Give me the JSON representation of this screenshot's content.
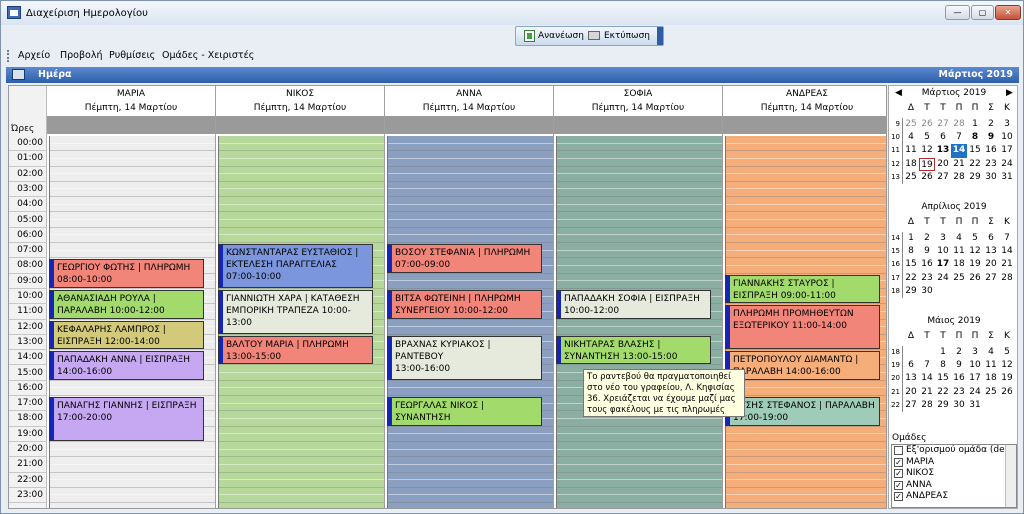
{
  "window": {
    "title": "Διαχείριση Ημερολογίου"
  },
  "toolbar": {
    "refresh_label": "Ανανέωση",
    "print_label": "Εκτύπωση"
  },
  "menu": [
    "Αρχείο",
    "Προβολή",
    "Ρυθμίσεις",
    "Ομάδες - Χειριστές"
  ],
  "daybar": {
    "view_label": "Ημέρα",
    "month_label": "Μάρτιος 2019"
  },
  "grid": {
    "hours_label": "Ώρες",
    "hours": [
      "00:00",
      "01:00",
      "02:00",
      "03:00",
      "04:00",
      "05:00",
      "06:00",
      "07:00",
      "08:00",
      "09:00",
      "10:00",
      "11:00",
      "12:00",
      "13:00",
      "14:00",
      "15:00",
      "16:00",
      "17:00",
      "18:00",
      "19:00",
      "20:00",
      "21:00",
      "22:00",
      "23:00"
    ],
    "columns": [
      {
        "name": "ΜΑΡΙΑ",
        "date": "Πέμπτη, 14 Μαρτίου",
        "color": "#eeeeee",
        "appointments": [
          {
            "title": "ΓΕΩΡΓΙΟΥ ΦΩΤΗΣ | ΠΛΗΡΩΜΗ",
            "time": "08:00-10:00",
            "color": "#f2857a",
            "start": 8,
            "end": 10
          },
          {
            "title": "ΑΘΑΝΑΣΙΑΔΗ ΡΟΥΛΑ | ΠΑΡΑΛΑΒΗ 10:00-12:00",
            "time": "",
            "color": "#a2db6b",
            "start": 10,
            "end": 12
          },
          {
            "title": "ΚΕΦΑΛΑΡΗΣ ΛΑΜΠΡΟΣ | ΕΙΣΠΡΑΞΗ 12:00-14:00",
            "time": "",
            "color": "#d3c97a",
            "start": 12,
            "end": 14
          },
          {
            "title": "ΠΑΠΑΔΑΚΗ ΑΝΝΑ | ΕΙΣΠΡΑΞΗ",
            "time": "14:00-16:00",
            "color": "#c6a8f2",
            "start": 14,
            "end": 16
          },
          {
            "title": "ΠΑΝΑΓΗΣ ΓΙΑΝΝΗΣ | ΕΙΣΠΡΑΞΗ",
            "time": "17:00-20:00",
            "color": "#c6a8f2",
            "start": 17,
            "end": 20
          }
        ]
      },
      {
        "name": "ΝΙΚΟΣ",
        "date": "Πέμπτη, 14 Μαρτίου",
        "color": "#b6d99b",
        "appointments": [
          {
            "title": "ΚΩΝΣΤΑΝΤΑΡΑΣ ΕΥΣΤΑΘΙΟΣ | ΕΚΤΕΛΕΣΗ ΠΑΡΑΓΓΕΛΙΑΣ",
            "time": "07:00-10:00",
            "color": "#7b96dd",
            "start": 7,
            "end": 10
          },
          {
            "title": "ΓΙΑΝΝΙΩΤΗ ΧΑΡΑ | ΚΑΤΑΘΕΣΗ ΕΜΠΟΡΙΚΗ ΤΡΑΠΕΖΑ 10:00-13:00",
            "time": "",
            "color": "#e6eadd",
            "start": 10,
            "end": 13
          },
          {
            "title": "ΒΑΛΤΟΥ ΜΑΡΙΑ | ΠΛΗΡΩΜΗ",
            "time": "13:00-15:00",
            "color": "#f2857a",
            "start": 13,
            "end": 15
          }
        ]
      },
      {
        "name": "ΑΝΝΑ",
        "date": "Πέμπτη, 14 Μαρτίου",
        "color": "#8b9fc0",
        "appointments": [
          {
            "title": "ΒΟΣΟΥ ΣΤΕΦΑΝΙΑ | ΠΛΗΡΩΜΗ",
            "time": "07:00-09:00",
            "color": "#f2857a",
            "start": 7,
            "end": 9
          },
          {
            "title": "ΒΙΤΣΑ ΦΩΤΕΙΝΗ | ΠΛΗΡΩΜΗ ΣΥΝΕΡΓΕΙΟΥ 10:00-12:00",
            "time": "",
            "color": "#f2857a",
            "start": 10,
            "end": 12
          },
          {
            "title": "ΒΡΑΧΝΑΣ ΚΥΡΙΑΚΟΣ | ΡΑΝΤΕΒΟΥ",
            "time": "13:00-16:00",
            "color": "#e6eadd",
            "start": 13,
            "end": 16
          },
          {
            "title": "ΓΕΩΡΓΑΛΑΣ ΝΙΚΟΣ | ΣΥΝΑΝΤΗΣΗ",
            "time": "17:00-19:00",
            "color": "#a2db6b",
            "start": 17,
            "end": 19
          }
        ]
      },
      {
        "name": "ΣΟΦΙΑ",
        "date": "Πέμπτη, 14 Μαρτίου",
        "color": "#8aaea2",
        "appointments": [
          {
            "title": "ΠΑΠΑΔΑΚΗ ΣΟΦΙΑ | ΕΙΣΠΡΑΞΗ",
            "time": "10:00-12:00",
            "color": "#e6eadd",
            "start": 10,
            "end": 12
          },
          {
            "title": "ΝΙΚΗΤΑΡΑΣ ΒΛΑΣΗΣ | ΣΥΝΑΝΤΗΣΗ 13:00-15:00",
            "time": "",
            "color": "#a2db6b",
            "start": 13,
            "end": 15
          }
        ]
      },
      {
        "name": "ΑΝΔΡΕΑΣ",
        "date": "Πέμπτη, 14 Μαρτίου",
        "color": "#f5ad7a",
        "appointments": [
          {
            "title": "ΓΙΑΝΝΑΚΗΣ ΣΤΑΥΡΟΣ | ΕΙΣΠΡΑΞΗ 09:00-11:00",
            "time": "",
            "color": "#a2db6b",
            "start": 9,
            "end": 11
          },
          {
            "title": "ΠΛΗΡΩΜΗ ΠΡΟΜΗΘΕΥΤΩΝ ΕΞΩΤΕΡΙΚΟΥ 11:00-14:00",
            "time": "",
            "color": "#f2857a",
            "start": 11,
            "end": 14
          },
          {
            "title": "ΠΕΤΡΟΠΟΥΛΟΥ ΔΙΑΜΑΝΤΩ | ΠΑΡΑΛΑΒΗ 14:00-16:00",
            "time": "",
            "color": "#f5ad7a",
            "start": 14,
            "end": 16
          },
          {
            "title": "ΟΤΣΗΣ ΣΤΕΦΑΝΟΣ | ΠΑΡΑΛΑΒΗ 17:00-19:00",
            "time": "",
            "color": "#9fcbb9",
            "start": 17,
            "end": 19
          }
        ]
      }
    ]
  },
  "tooltip": {
    "text": "Το ραντεβού θα πραγματοποιηθεί στο νέο του γραφείου, Λ. Κηφισίας 36. Χρειάζεται να έχουμε μαζί μας τους φακέλους με τις πληρωμές"
  },
  "minical": {
    "weekdays": [
      "Δ",
      "Τ",
      "Τ",
      "Π",
      "Π",
      "Σ",
      "Κ"
    ],
    "months": [
      {
        "title": "Μάρτιος 2019",
        "weeks": [
          {
            "wk": "9",
            "days": [
              "25",
              "26",
              "27",
              "28",
              "1",
              "2",
              "3"
            ],
            "dim": [
              1,
              1,
              1,
              1,
              0,
              0,
              0
            ]
          },
          {
            "wk": "10",
            "days": [
              "4",
              "5",
              "6",
              "7",
              "8",
              "9",
              "10"
            ],
            "dim": [
              0,
              0,
              0,
              0,
              0,
              0,
              0
            ],
            "bold": [
              4,
              5
            ]
          },
          {
            "wk": "11",
            "days": [
              "11",
              "12",
              "13",
              "14",
              "15",
              "16",
              "17"
            ],
            "dim": [
              0,
              0,
              0,
              0,
              0,
              0,
              0
            ],
            "bold": [
              2
            ],
            "sel": 3
          },
          {
            "wk": "12",
            "days": [
              "18",
              "19",
              "20",
              "21",
              "22",
              "23",
              "24"
            ],
            "dim": [
              0,
              0,
              0,
              0,
              0,
              0,
              0
            ],
            "today": 1
          },
          {
            "wk": "13",
            "days": [
              "25",
              "26",
              "27",
              "28",
              "29",
              "30",
              "31"
            ],
            "dim": [
              0,
              0,
              0,
              0,
              0,
              0,
              0
            ]
          }
        ]
      },
      {
        "title": "Απρίλιος 2019",
        "weeks": [
          {
            "wk": "14",
            "days": [
              "1",
              "2",
              "3",
              "4",
              "5",
              "6",
              "7"
            ],
            "dim": [
              0,
              0,
              0,
              0,
              0,
              0,
              0
            ]
          },
          {
            "wk": "15",
            "days": [
              "8",
              "9",
              "10",
              "11",
              "12",
              "13",
              "14"
            ],
            "dim": [
              0,
              0,
              0,
              0,
              0,
              0,
              0
            ]
          },
          {
            "wk": "16",
            "days": [
              "15",
              "16",
              "17",
              "18",
              "19",
              "20",
              "21"
            ],
            "dim": [
              0,
              0,
              0,
              0,
              0,
              0,
              0
            ],
            "bold": [
              2
            ]
          },
          {
            "wk": "17",
            "days": [
              "22",
              "23",
              "24",
              "25",
              "26",
              "27",
              "28"
            ],
            "dim": [
              0,
              0,
              0,
              0,
              0,
              0,
              0
            ]
          },
          {
            "wk": "18",
            "days": [
              "29",
              "30",
              "",
              "",
              "",
              "",
              ""
            ],
            "dim": [
              0,
              0,
              0,
              0,
              0,
              0,
              0
            ]
          }
        ]
      },
      {
        "title": "Μάιος 2019",
        "weeks": [
          {
            "wk": "18",
            "days": [
              "",
              "",
              "1",
              "2",
              "3",
              "4",
              "5"
            ],
            "dim": [
              0,
              0,
              0,
              0,
              0,
              0,
              0
            ]
          },
          {
            "wk": "19",
            "days": [
              "6",
              "7",
              "8",
              "9",
              "10",
              "11",
              "12"
            ],
            "dim": [
              0,
              0,
              0,
              0,
              0,
              0,
              0
            ]
          },
          {
            "wk": "20",
            "days": [
              "13",
              "14",
              "15",
              "16",
              "17",
              "18",
              "19"
            ],
            "dim": [
              0,
              0,
              0,
              0,
              0,
              0,
              0
            ]
          },
          {
            "wk": "21",
            "days": [
              "20",
              "21",
              "22",
              "23",
              "24",
              "25",
              "26"
            ],
            "dim": [
              0,
              0,
              0,
              0,
              0,
              0,
              0
            ]
          },
          {
            "wk": "22",
            "days": [
              "27",
              "28",
              "29",
              "30",
              "31",
              "",
              ""
            ],
            "dim": [
              0,
              0,
              0,
              0,
              0,
              0,
              0
            ]
          }
        ]
      }
    ]
  },
  "groups": {
    "title": "Ομάδες",
    "items": [
      {
        "label": "Εξ'ορισμού ομάδα (dei",
        "checked": false
      },
      {
        "label": "ΜΑΡΙΑ",
        "checked": true
      },
      {
        "label": "ΝΙΚΟΣ",
        "checked": true
      },
      {
        "label": "ΑΝΝΑ",
        "checked": true
      },
      {
        "label": "ΑΝΔΡΕΑΣ",
        "checked": true
      }
    ]
  }
}
